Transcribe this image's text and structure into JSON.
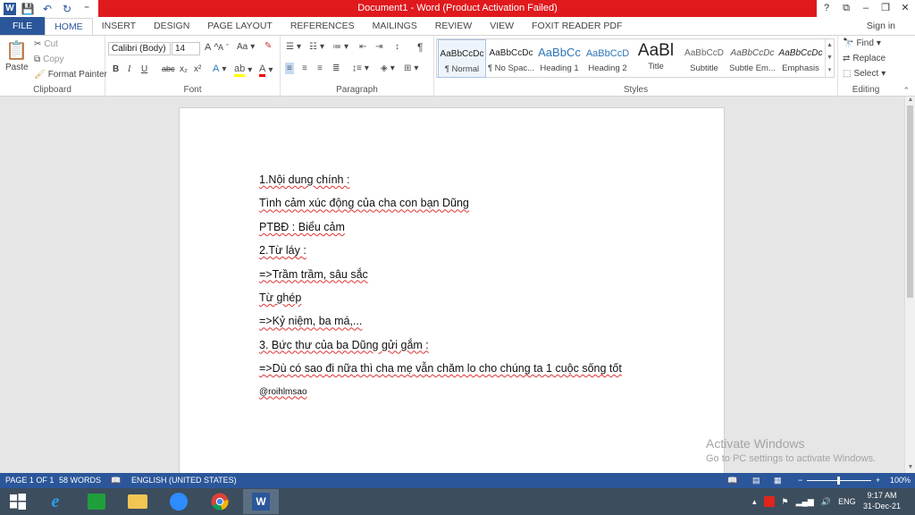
{
  "window": {
    "title": "Document1 - Word (Product Activation Failed)",
    "help": "?",
    "controls": [
      "⧉",
      "–",
      "❐",
      "✕"
    ]
  },
  "qat": {
    "save": "💾",
    "undo": "↶",
    "redo": "↻",
    "more": "⁼"
  },
  "tabs": [
    "FILE",
    "HOME",
    "INSERT",
    "DESIGN",
    "PAGE LAYOUT",
    "REFERENCES",
    "MAILINGS",
    "REVIEW",
    "VIEW",
    "FOXIT READER PDF"
  ],
  "signin": "Sign in",
  "ribbon": {
    "clipboard": {
      "label": "Clipboard",
      "paste": "Paste",
      "cut": "Cut",
      "copy": "Copy",
      "format_painter": "Format Painter"
    },
    "font": {
      "label": "Font",
      "name": "Calibri (Body)",
      "size": "14",
      "bold": "B",
      "italic": "I",
      "underline": "U",
      "strike": "abc",
      "sub": "x₂",
      "sup": "x²",
      "change_case": "Aa",
      "grow": "A",
      "shrink": "A"
    },
    "paragraph": {
      "label": "Paragraph",
      "pilcrow": "¶"
    },
    "styles": {
      "label": "Styles",
      "items": [
        {
          "preview": "AaBbCcDc",
          "name": "¶ Normal"
        },
        {
          "preview": "AaBbCcDc",
          "name": "¶ No Spac..."
        },
        {
          "preview": "AaBbCc",
          "name": "Heading 1"
        },
        {
          "preview": "AaBbCcD",
          "name": "Heading 2"
        },
        {
          "preview": "AaBl",
          "name": "Title"
        },
        {
          "preview": "AaBbCcD",
          "name": "Subtitle"
        },
        {
          "preview": "AaBbCcDc",
          "name": "Subtle Em..."
        },
        {
          "preview": "AaBbCcDc",
          "name": "Emphasis"
        }
      ]
    },
    "editing": {
      "label": "Editing",
      "find": "Find",
      "replace": "Replace",
      "select": "Select"
    }
  },
  "document": {
    "lines": [
      "1.Nội dung chính :",
      "Tình cảm xúc động của cha con bạn Dũng",
      "PTBĐ : Biểu cảm",
      "2.Từ láy :",
      "=>Trầm trầm, sâu sắc",
      "Từ ghép",
      "=>Kỷ niệm, ba má,...",
      "3. Bức thư của ba Dũng gửi gắm :",
      "=>Dù có sao đi nữa thì cha mẹ vẫn chăm lo cho chúng ta 1 cuộc sống tốt",
      "@roihlmsao"
    ]
  },
  "watermark": {
    "line1": "Activate Windows",
    "line2": "Go to PC settings to activate Windows."
  },
  "status": {
    "page": "PAGE 1 OF 1",
    "words": "58 WORDS",
    "language": "ENGLISH (UNITED STATES)",
    "zoom": "100%"
  },
  "taskbar": {
    "lang": "ENG",
    "time": "9:17 AM",
    "date": "31-Dec-21"
  },
  "colors": {
    "word_blue": "#2b579a",
    "title_red": "#e0191d",
    "taskbar": "#3c4d5e"
  }
}
